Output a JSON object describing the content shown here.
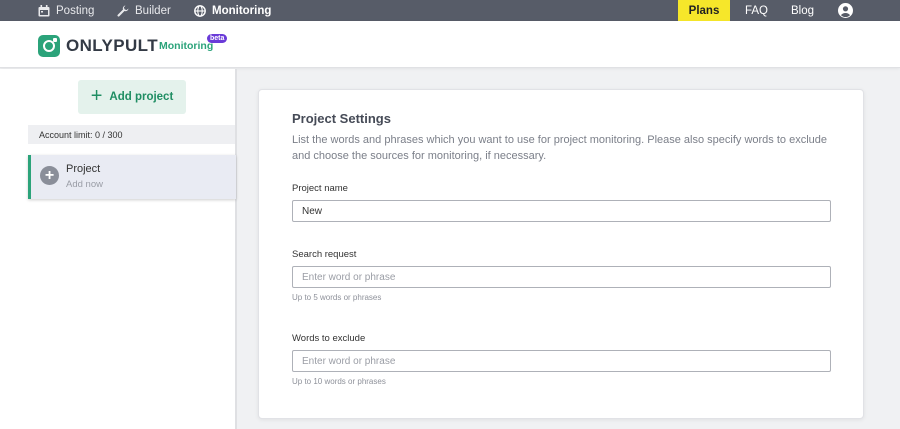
{
  "topnav": {
    "posting": "Posting",
    "builder": "Builder",
    "monitoring": "Monitoring",
    "plans": "Plans",
    "faq": "FAQ",
    "blog": "Blog",
    "plans_bg": "#f6e72a",
    "bar_color": "#575c68"
  },
  "header": {
    "logo_text": "ONLYPULT",
    "logo_sub": "Monitoring",
    "beta": "beta",
    "brand_color": "#2ba37a"
  },
  "sidebar": {
    "add_project": "Add project",
    "account_limit": "Account limit: 0 / 300",
    "project": {
      "title": "Project",
      "subtitle": "Add now"
    }
  },
  "settings": {
    "title": "Project Settings",
    "description": "List the words and phrases which you want to use for project monitoring. Please also specify words to exclude and choose the sources for monitoring, if necessary.",
    "project_name": {
      "label": "Project name",
      "value": "New"
    },
    "search_request": {
      "label": "Search request",
      "placeholder": "Enter word or phrase",
      "hint": "Up to 5 words or phrases"
    },
    "exclude": {
      "label": "Words to exclude",
      "placeholder": "Enter word or phrase",
      "hint": "Up to 10 words or phrases"
    }
  }
}
